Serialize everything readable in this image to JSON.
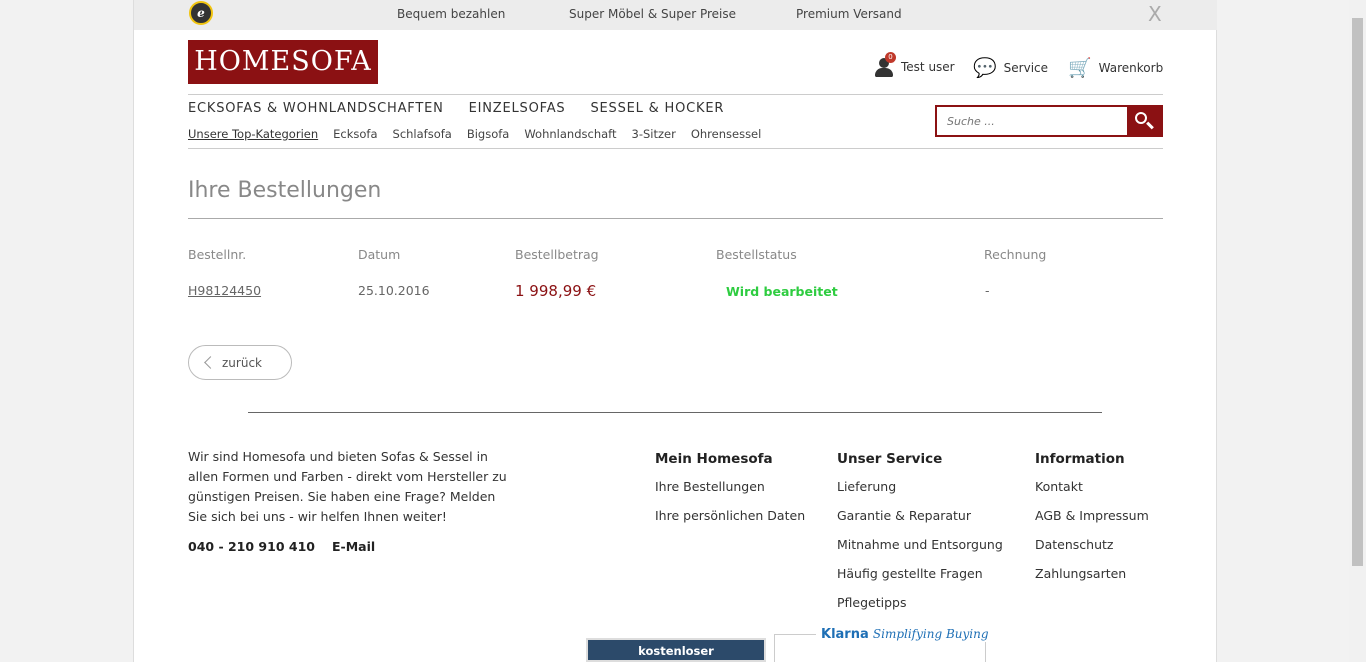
{
  "topbar": {
    "trust_badge": "e",
    "usps": [
      "Bequem bezahlen",
      "Super Möbel & Super Preise",
      "Premium Versand"
    ],
    "close": "X"
  },
  "header": {
    "logo": "HOMESOFA",
    "user_label": "Test user",
    "user_badge": "0",
    "service_label": "Service",
    "cart_label": "Warenkorb"
  },
  "nav": {
    "main": [
      "ECKSOFAS & WOHNLANDSCHAFTEN",
      "EINZELSOFAS",
      "SESSEL & HOCKER"
    ],
    "sub": [
      "Unsere Top-Kategorien",
      "Ecksofa",
      "Schlafsofa",
      "Bigsofa",
      "Wohnlandschaft",
      "3-Sitzer",
      "Ohrensessel"
    ]
  },
  "search": {
    "placeholder": "Suche ..."
  },
  "orders": {
    "title": "Ihre Bestellungen",
    "columns": [
      "Bestellnr.",
      "Datum",
      "Bestellbetrag",
      "Bestellstatus",
      "Rechnung"
    ],
    "rows": [
      {
        "number": "H98124450",
        "date": "25.10.2016",
        "amount": "1 998,99 €",
        "status": "Wird bearbeitet",
        "invoice": "-"
      }
    ],
    "back_label": "zurück"
  },
  "footer": {
    "about": "Wir sind Homesofa und bieten Sofas & Sessel in allen Formen und Farben - direkt vom Hersteller zu günstigen Preisen. Sie haben eine Frage? Melden Sie sich bei uns - wir helfen Ihnen weiter!",
    "phone": "040 - 210 910 410",
    "email": "E-Mail",
    "columns": [
      {
        "title": "Mein Homesofa",
        "items": [
          "Ihre Bestellungen",
          "Ihre persönlichen Daten"
        ]
      },
      {
        "title": "Unser Service",
        "items": [
          "Lieferung",
          "Garantie & Reparatur",
          "Mitnahme und Entsorgung",
          "Häufig gestellte Fragen",
          "Pflegetipps"
        ]
      },
      {
        "title": "Information",
        "items": [
          "Kontakt",
          "AGB & Impressum",
          "Datenschutz",
          "Zahlungsarten"
        ]
      }
    ],
    "callback": "kostenloser Rückrufservice",
    "klarna_brand": "Klarna",
    "klarna_slogan": "Simplifying Buying"
  },
  "colors": {
    "brand": "#8b1113",
    "status_ok": "#2ecc40",
    "callback_bg": "#2c4a6a"
  }
}
